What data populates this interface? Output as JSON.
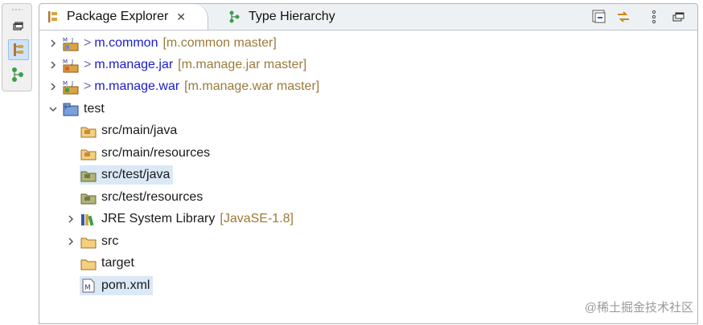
{
  "tabs": [
    {
      "label": "Package Explorer",
      "close": "✕",
      "active": true
    },
    {
      "label": "Type Hierarchy",
      "active": false
    }
  ],
  "tree": [
    {
      "label": "m.common",
      "prefix": ">",
      "decoration": "[m.common master]",
      "kind": "project",
      "expanded": false
    },
    {
      "label": "m.manage.jar",
      "prefix": ">",
      "decoration": "[m.manage.jar master]",
      "kind": "project",
      "expanded": false
    },
    {
      "label": "m.manage.war",
      "prefix": ">",
      "decoration": "[m.manage.war master]",
      "kind": "project",
      "expanded": false
    },
    {
      "label": "test",
      "kind": "project-test",
      "expanded": true
    },
    {
      "label": "src/main/java",
      "kind": "source-folder"
    },
    {
      "label": "src/main/resources",
      "kind": "source-folder"
    },
    {
      "label": "src/test/java",
      "kind": "test-source-folder",
      "selected": true
    },
    {
      "label": "src/test/resources",
      "kind": "test-source-folder"
    },
    {
      "label": "JRE System Library",
      "decoration": "[JavaSE-1.8]",
      "kind": "library",
      "expanded": false
    },
    {
      "label": "src",
      "kind": "folder",
      "expanded": false
    },
    {
      "label": "target",
      "kind": "folder"
    },
    {
      "label": "pom.xml",
      "kind": "file",
      "selected": true
    }
  ],
  "watermark": "@稀土掘金技术社区"
}
